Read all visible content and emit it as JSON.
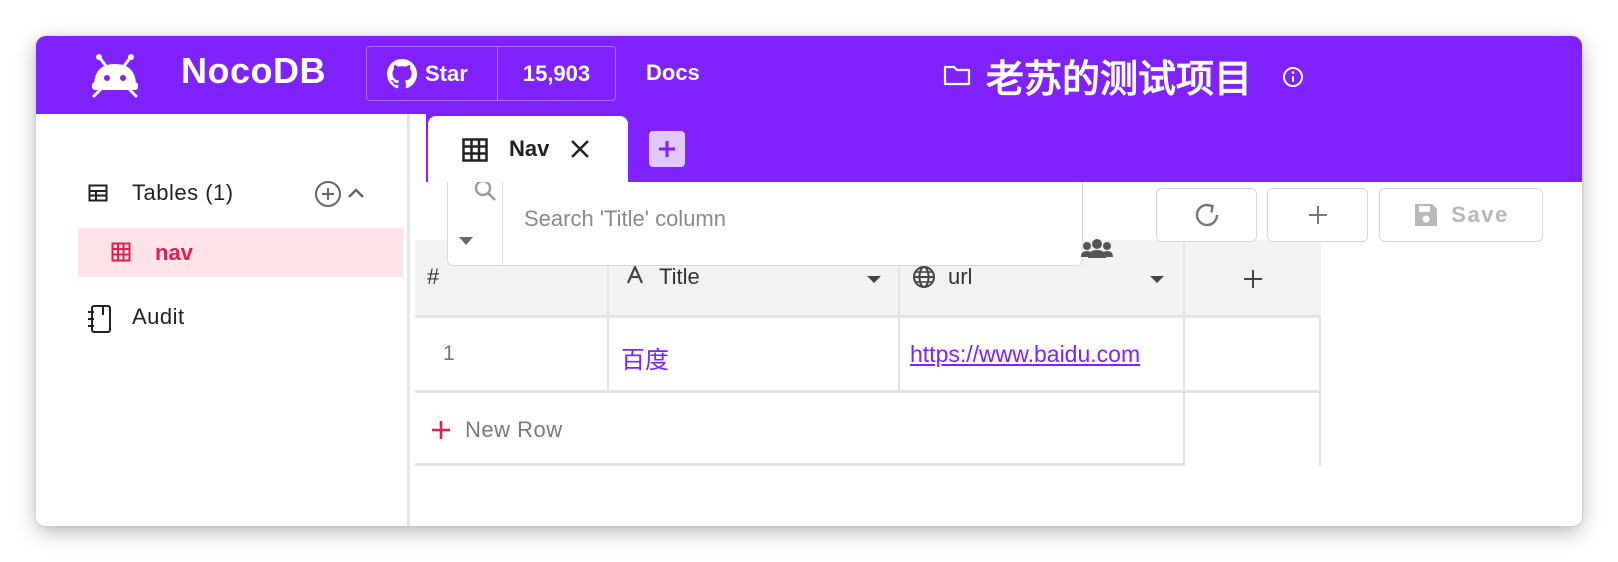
{
  "header": {
    "brand": "NocoDB",
    "github_star_label": "Star",
    "github_star_count": "15,903",
    "docs_label": "Docs",
    "project_title": "老苏的测试项目"
  },
  "tabs": [
    {
      "label": "Nav",
      "icon": "grid-icon"
    }
  ],
  "sidebar": {
    "tables_label": "Tables (1)",
    "items": [
      {
        "label": "nav"
      }
    ],
    "audit_label": "Audit"
  },
  "toolbar": {
    "search_placeholder": "Search 'Title' column",
    "save_label": "Save"
  },
  "grid": {
    "columns": [
      {
        "label": "#"
      },
      {
        "label": "Title",
        "icon": "text-type-icon"
      },
      {
        "label": "url",
        "icon": "globe-icon"
      }
    ],
    "rows": [
      {
        "index": "1",
        "title": "百度",
        "url": "https://www.baidu.com"
      }
    ],
    "new_row_label": "New Row"
  },
  "colors": {
    "brand": "#7f22fe",
    "active_table": "#e0204f",
    "active_table_bg": "#fde3e8",
    "link": "#7f22fe"
  }
}
